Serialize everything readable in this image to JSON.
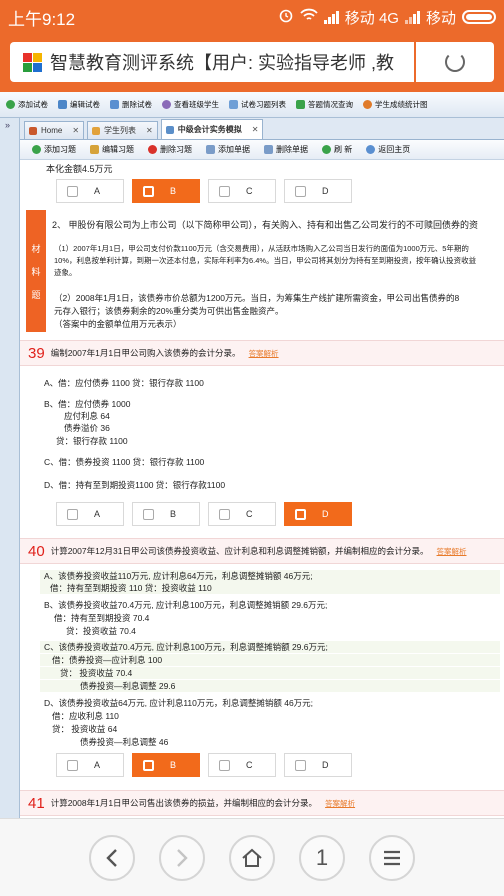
{
  "status": {
    "time": "上午9:12",
    "carrier1": "移动 4G",
    "carrier2": "移动"
  },
  "browser": {
    "url_text": "智慧教育测评系统【用户: 实验指导老师 ,教"
  },
  "toolbar": {
    "items": [
      "添加试卷",
      "编辑试卷",
      "删除试卷",
      "查看班级学生",
      "试卷习题列表",
      "答题情况查询",
      "学生成绩统计图"
    ]
  },
  "left_strip": {
    "label": "»"
  },
  "tabs": [
    {
      "label": "Home"
    },
    {
      "label": "学生列表"
    },
    {
      "label": "中级会计实务模拟"
    }
  ],
  "actions": [
    "添加习题",
    "编辑习题",
    "删除习题",
    "添加单据",
    "删除单据",
    "刷 新",
    "返回主页"
  ],
  "content": {
    "top_fragment": "本化金额4.5万元",
    "q_prev_options": [
      {
        "label": "A",
        "selected": false
      },
      {
        "label": "B",
        "selected": true
      },
      {
        "label": "C",
        "selected": false
      },
      {
        "label": "D",
        "selected": false
      }
    ],
    "material": {
      "label_chars": [
        "材",
        "料",
        "题"
      ],
      "title": "2、 甲股份有限公司为上市公司（以下简称甲公司），有关购入、持有和出售乙公司发行的不可赎回债券的资",
      "p1_line1": "（1）2007年1月1日，甲公司支付价款1100万元（含交易费用），从活跃市场购入乙公司当日发行的面值为1000万元、5年期的",
      "p1_line2": "10%，利息按单利计算，到期一次还本付息，实际年利率为6.4%。当日，甲公司将其划分为持有至到期投资，按年确认投资收益",
      "p1_line3": "迹象。",
      "p2_line1": "（2）2008年1月1日，该债券市价总额为1200万元。当日，为筹集生产线扩建所需资金，甲公司出售债券的8",
      "p2_line2": "元存入银行；该债券剩余的20%重分类为可供出售金融资产。",
      "p2_line3": "（答案中的金额单位用万元表示）"
    },
    "q39": {
      "number": "39",
      "text": "编制2007年1月1日甲公司购入该债券的会计分录。",
      "answer_link": "答案解析",
      "choices": {
        "A": "A、借：应付债券 1100        贷：银行存款 1100",
        "B1": "B、借：应付债券    1000",
        "B2": "应付利息    64",
        "B3": "债券溢价    36",
        "B4": "贷：银行存款   1100",
        "C": "C、借：债券投资 1100          贷：银行存款 1100",
        "D": "D、借：持有至到期投资1100      贷：银行存款1100"
      },
      "options": [
        {
          "label": "A",
          "selected": false
        },
        {
          "label": "B",
          "selected": false
        },
        {
          "label": "C",
          "selected": false
        },
        {
          "label": "D",
          "selected": true
        }
      ]
    },
    "q40": {
      "number": "40",
      "text": "计算2007年12月31日甲公司该债券投资收益、应计利息和利息调整摊销额，并编制相应的会计分录。",
      "answer_link": "答案解析",
      "choices": {
        "A1": "A、该债券投资收益110万元, 应计利息64万元，利息调整摊销额 46万元;",
        "A2": "借：持有至到期投资  110    贷：投资收益  110",
        "B1": "B、该债券投资收益70.4万元, 应计利息100万元，利息调整摊销额  29.6万元;",
        "B2": "借：持有至到期投资     70.4",
        "B3": "贷：投资收益   70.4",
        "C1": "C、该债券投资收益70.4万元, 应计利息100万元，利息调整摊销额  29.6万元;",
        "C2": "借：债券投资—应计利息     100",
        "C3": "贷：  投资收益  70.4",
        "C4": "债券投资—利息调整  29.6",
        "D1": "D、该债券投资收益64万元, 应计利息110万元，利息调整摊销额  46万元;",
        "D2": "借：应收利息    110",
        "D3": "贷：   投资收益    64",
        "D4": "债券投资—利息调整  46"
      },
      "options": [
        {
          "label": "A",
          "selected": false
        },
        {
          "label": "B",
          "selected": true
        },
        {
          "label": "C",
          "selected": false
        },
        {
          "label": "D",
          "selected": false
        }
      ]
    },
    "q41": {
      "number": "41",
      "text": "计算2008年1月1日甲公司售出该债券的损益，并编制相应的会计分录。",
      "answer_link": "答案解析"
    }
  },
  "bottom_nav": {
    "tabs_count": "1"
  },
  "colors": {
    "accent": "#ec6a2b",
    "selected": "#f26a1b",
    "qnum": "#e0201a"
  }
}
